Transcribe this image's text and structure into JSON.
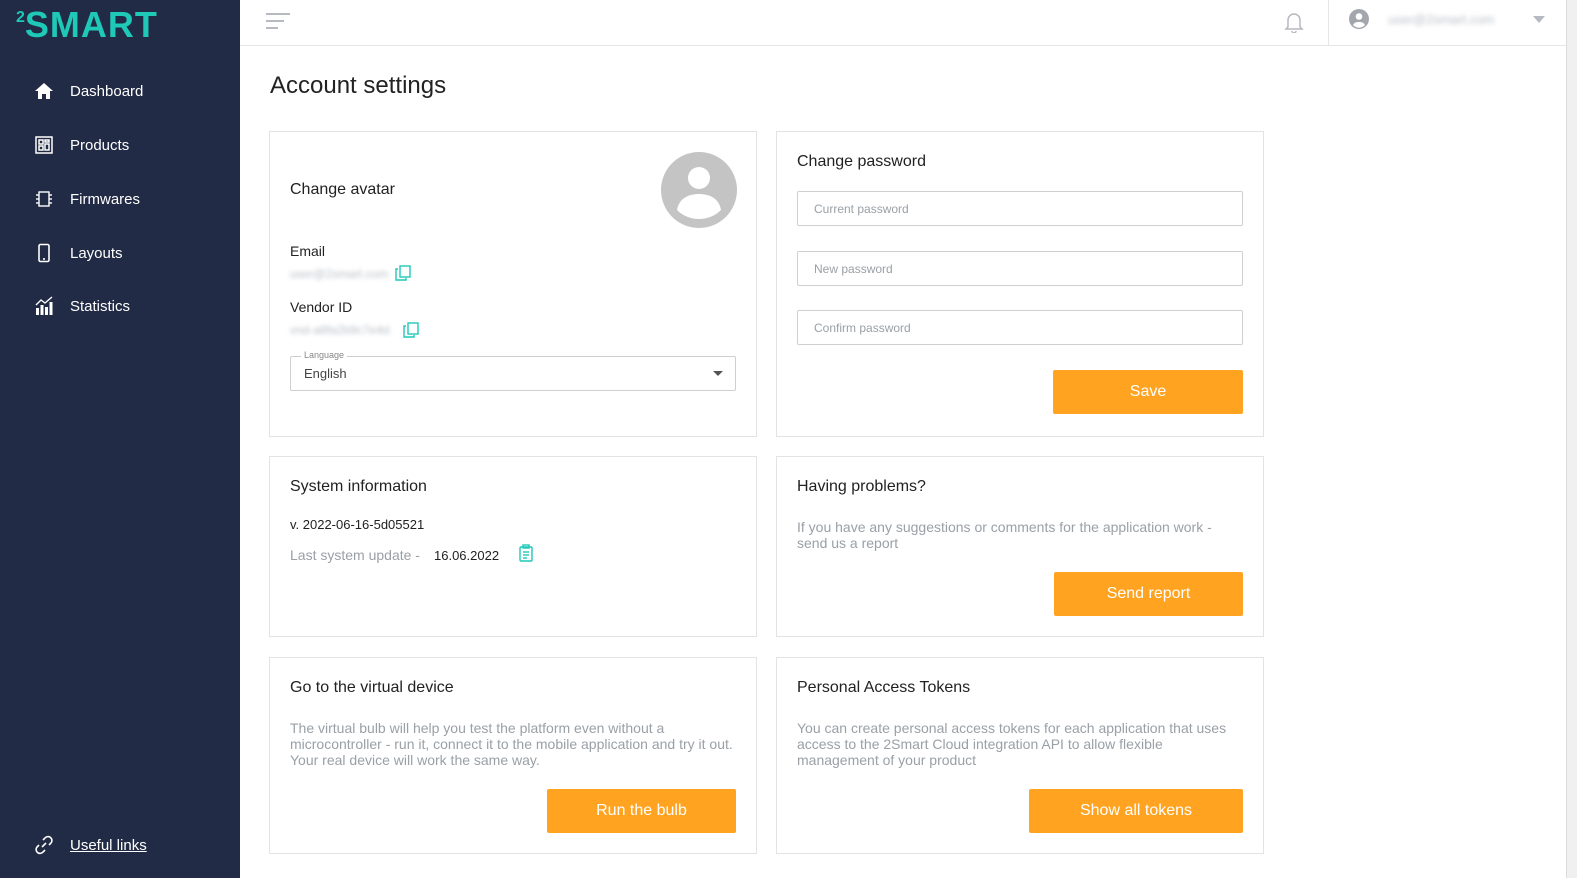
{
  "app": {
    "logo_super": "2",
    "logo_word": "SMART"
  },
  "sidebar": {
    "items": [
      {
        "label": "Dashboard",
        "icon": "home-icon"
      },
      {
        "label": "Products",
        "icon": "products-icon"
      },
      {
        "label": "Firmwares",
        "icon": "chip-icon"
      },
      {
        "label": "Layouts",
        "icon": "phone-icon"
      },
      {
        "label": "Statistics",
        "icon": "bar-chart-icon"
      }
    ],
    "useful_links": "Useful links"
  },
  "topbar": {
    "user_email": "user@2smart.com"
  },
  "page": {
    "title": "Account settings"
  },
  "avatar_card": {
    "title": "Change avatar",
    "email_label": "Email",
    "email_value": "user@2smart.com",
    "vendor_label": "Vendor ID",
    "vendor_value": "vnd-a8fa2b9c7e4d",
    "language_legend": "Language",
    "language_value": "English"
  },
  "password_card": {
    "title": "Change password",
    "current_placeholder": "Current password",
    "new_placeholder": "New password",
    "confirm_placeholder": "Confirm password",
    "save_label": "Save"
  },
  "system_card": {
    "title": "System information",
    "version": "v. 2022-06-16-5d05521",
    "last_update_label": "Last system update -",
    "last_update_value": "16.06.2022"
  },
  "problems_card": {
    "title": "Having problems?",
    "description": "If you have any suggestions or comments for the application work - send us a report",
    "button_label": "Send report"
  },
  "virtual_card": {
    "title": "Go to the virtual device",
    "description": "The virtual bulb will help you test the platform even without a microcontroller - run it, connect it to the mobile application and try it out. Your real device will work the same way.",
    "button_label": "Run the bulb"
  },
  "tokens_card": {
    "title": "Personal Access Tokens",
    "description": "You can create personal access tokens for each application that uses access to the 2Smart Cloud integration API to allow flexible management of your product",
    "button_label": "Show all tokens"
  },
  "colors": {
    "sidebar_bg": "#222b45",
    "accent": "#ffa321",
    "brand": "#1ec9b7"
  }
}
